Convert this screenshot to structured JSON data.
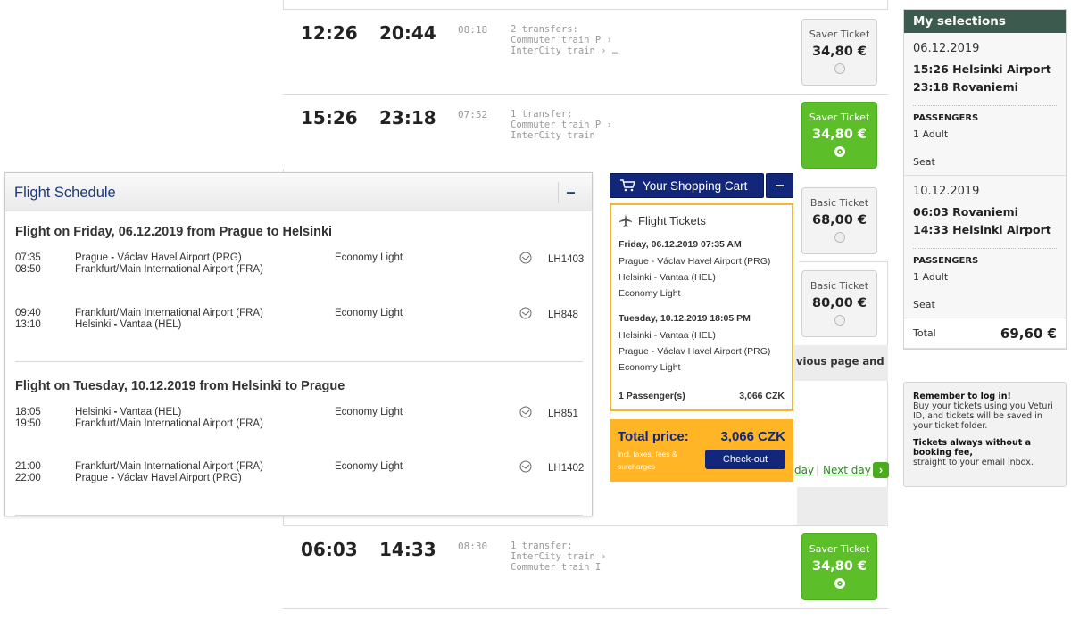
{
  "trains": [
    {
      "dep": "12:26",
      "arr": "20:44",
      "duration": "08:18",
      "transfers": [
        "2 transfers:",
        "Commuter train P ›",
        "InterCity train › …"
      ],
      "ticket": {
        "name": "Saver Ticket",
        "price": "34,80 €"
      }
    },
    {
      "dep": "15:26",
      "arr": "23:18",
      "duration": "07:52",
      "transfers": [
        "1 transfer:",
        "Commuter train P ›",
        "InterCity train"
      ],
      "ticket": {
        "name": "Saver Ticket",
        "price": "34,80 €"
      }
    },
    {
      "dep": "06:03",
      "arr": "14:33",
      "duration": "08:30",
      "transfers": [
        "1 transfer:",
        "InterCity train ›",
        "Commuter train I"
      ],
      "ticket": {
        "name": "Saver Ticket",
        "price": "34,80 €"
      }
    }
  ],
  "extra_tickets": [
    {
      "name": "Basic Ticket",
      "price": "68,00 €"
    },
    {
      "name": "Basic Ticket",
      "price": "80,00 €"
    }
  ],
  "partial_text": "vious page and",
  "day_nav": {
    "prev_partial": "day",
    "separator": "|",
    "next": "Next day"
  },
  "selections": {
    "title": "My selections",
    "outbound": {
      "date": "06.12.2019",
      "line1": "15:26 Helsinki Airport",
      "line2": "23:18 Rovaniemi",
      "passengers_label": "PASSENGERS",
      "passengers": "1 Adult",
      "seat": "Seat"
    },
    "return": {
      "date": "10.12.2019",
      "line1": "06:03 Rovaniemi",
      "line2": "14:33 Helsinki Airport",
      "passengers_label": "PASSENGERS",
      "passengers": "1 Adult",
      "seat": "Seat"
    },
    "total_label": "Total",
    "total_value": "69,60 €"
  },
  "info": {
    "login_title": "Remember to log in!",
    "login_text": "Buy your tickets using you Veturi ID, and tickets will be saved in your ticket folder.",
    "fee_title": "Tickets always without a booking fee,",
    "fee_text": "straight to your email inbox."
  },
  "flight_schedule": {
    "title": "Flight Schedule",
    "collapse": "–",
    "outbound_title": "Flight on Friday, 06.12.2019 from Prague to Helsinki",
    "return_title": "Flight on Tuesday, 10.12.2019 from Helsinki to Prague",
    "segments": [
      {
        "t1": "07:35",
        "t2": "08:50",
        "from_city": "Prague",
        "from_airport": "Václav Havel Airport (PRG)",
        "to": "Frankfurt/Main International Airport (FRA)",
        "class": "Economy Light",
        "flight": "LH1403"
      },
      {
        "t1": "09:40",
        "t2": "13:10",
        "from": "Frankfurt/Main International Airport (FRA)",
        "to_city": "Helsinki",
        "to_airport": "Vantaa (HEL)",
        "class": "Economy Light",
        "flight": "LH848"
      },
      {
        "t1": "18:05",
        "t2": "19:50",
        "from_city": "Helsinki",
        "from_airport": "Vantaa (HEL)",
        "to": "Frankfurt/Main International Airport (FRA)",
        "class": "Economy Light",
        "flight": "LH851"
      },
      {
        "t1": "21:00",
        "t2": "22:00",
        "from": "Frankfurt/Main International Airport (FRA)",
        "to_city": "Prague",
        "to_airport": "Václav Havel Airport (PRG)",
        "class": "Economy Light",
        "flight": "LH1402"
      }
    ]
  },
  "cart": {
    "button": "Your Shopping Cart",
    "collapse": "–",
    "section": "Flight Tickets",
    "out_date": "Friday, 06.12.2019 07:35 AM",
    "out_from": "Prague - Václav Havel Airport (PRG)",
    "out_to": "Helsinki - Vantaa (HEL)",
    "out_class": "Economy Light",
    "ret_date": "Tuesday, 10.12.2019 18:05 PM",
    "ret_from": "Helsinki - Vantaa (HEL)",
    "ret_to": "Prague - Václav Havel Airport (PRG)",
    "ret_class": "Economy Light",
    "passengers": "1 Passenger(s)",
    "passengers_price": "3,066 CZK",
    "total_label": "Total price:",
    "total_value": "3,066 CZK",
    "total_note": "incl. taxes, fees & surcharges",
    "checkout": "Check-out"
  },
  "colors": {
    "green": "#5cbf2a",
    "navy": "#13277a",
    "orange": "#ffb526",
    "sidebar_header": "#3d5a4e"
  }
}
